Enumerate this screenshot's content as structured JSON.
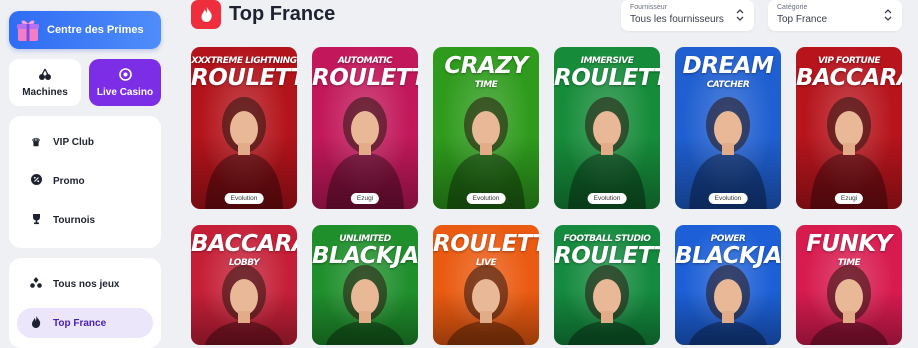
{
  "sidebar": {
    "promo_button": "Centre des Primes",
    "tiles": {
      "machines": "Machines",
      "live_casino": "Live Casino"
    },
    "menu_top": [
      {
        "label": "VIP Club"
      },
      {
        "label": "Promo"
      },
      {
        "label": "Tournois"
      }
    ],
    "menu_bottom": [
      {
        "label": "Tous nos jeux"
      },
      {
        "label": "Top France"
      }
    ]
  },
  "header": {
    "title": "Top France",
    "provider_filter": {
      "label": "Fournisseur",
      "value": "Tous les fournisseurs"
    },
    "category_filter": {
      "label": "Catégorie",
      "value": "Top France"
    }
  },
  "games": [
    {
      "top": "XXXTREME LIGHTNING",
      "main": "ROULETTE",
      "provider": "Evolution",
      "color": "#b3131a"
    },
    {
      "top": "AUTOMATIC",
      "main": "ROULETTE",
      "provider": "Ezugi",
      "color": "#c2185b"
    },
    {
      "top": "CRAZY",
      "main": "TIME",
      "provider": "Evolution",
      "color": "#2e9b1c"
    },
    {
      "top": "IMMERSIVE",
      "main": "ROULETTE",
      "provider": "Evolution",
      "color": "#168c3a"
    },
    {
      "top": "DREAM",
      "main": "CATCHER",
      "provider": "Evolution",
      "color": "#1f5fd1"
    },
    {
      "top": "VIP FORTUNE",
      "main": "BACCARAT",
      "provider": "Ezugi",
      "color": "#b7141c"
    },
    {
      "top": "BACCARAT",
      "main": "LOBBY",
      "color": "#c51f37"
    },
    {
      "top": "UNLIMITED",
      "main": "BLACKJACK",
      "color": "#1f8f2c"
    },
    {
      "top": "ROULETTE",
      "main": "LIVE",
      "color": "#ea5a10"
    },
    {
      "top": "FOOTBALL STUDIO",
      "main": "ROULETTE",
      "color": "#148a3e"
    },
    {
      "top": "POWER",
      "main": "BLACKJACK",
      "color": "#1c5fd6"
    },
    {
      "top": "FUNKY",
      "main": "TIME",
      "color": "#d81b4f"
    }
  ]
}
